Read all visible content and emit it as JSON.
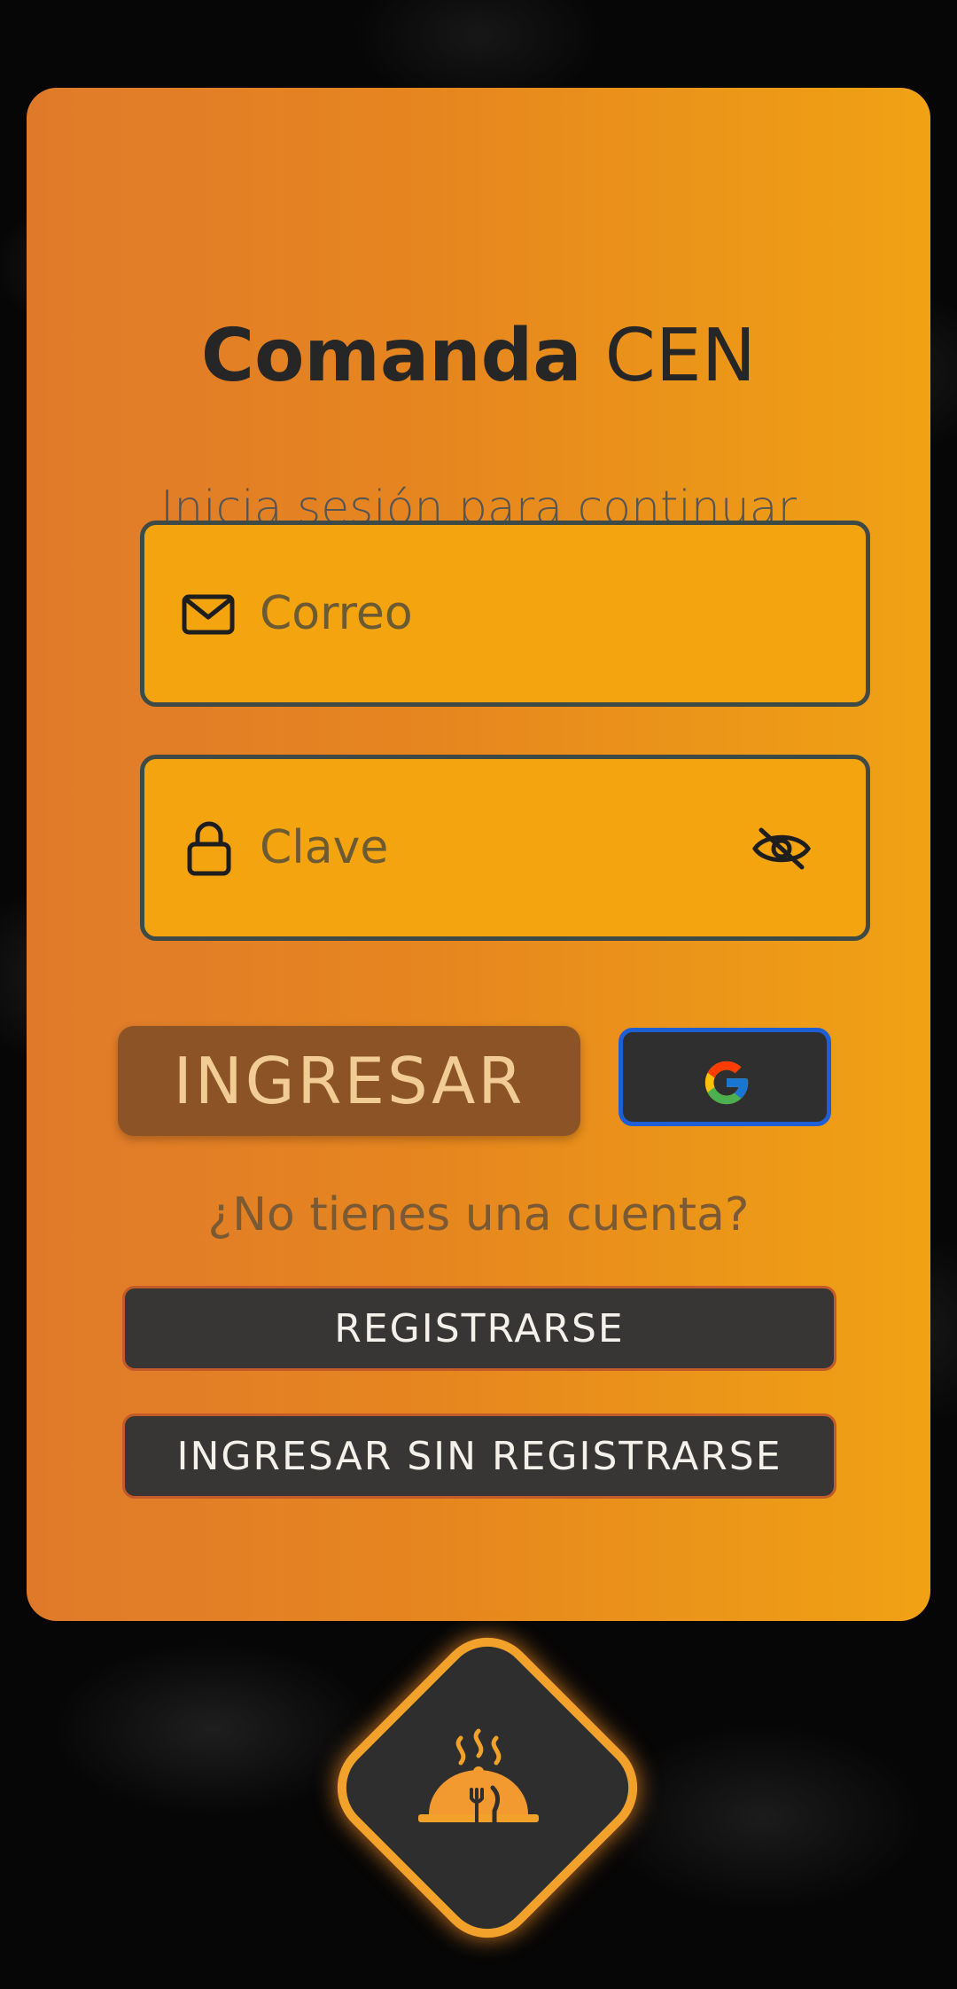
{
  "app": {
    "title_bold": "Comanda",
    "title_regular": " CEN",
    "subtitle": "Inicia sesión para continuar"
  },
  "form": {
    "email_placeholder": "Correo",
    "password_placeholder": "Clave",
    "login_label": "INGRESAR",
    "google_label": "Google"
  },
  "signup": {
    "question": "¿No tienes una cuenta?",
    "register_label": "REGISTRARSE",
    "guest_label": "INGRESAR SIN REGISTRARSE"
  },
  "colors": {
    "card_start": "#e07a2b",
    "card_end": "#f0a214",
    "field_bg": "#f4a40e",
    "dark_button": "#383635",
    "google_border": "#1f5fd6"
  },
  "icons": [
    "mail-icon",
    "lock-icon",
    "eye-off-icon",
    "google-icon",
    "restaurant-logo-icon"
  ]
}
